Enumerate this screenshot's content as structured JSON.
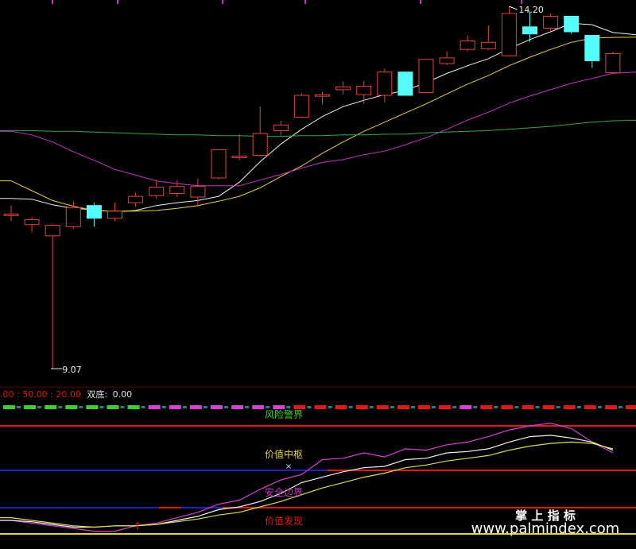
{
  "colors": {
    "background": "#000000",
    "up": "#e8413c",
    "down": "#54fcfc",
    "ma_white": "#f0f0f0",
    "ma_yellow": "#e6d23c",
    "ma_purple": "#c833c8",
    "ma_green": "#2ca84a",
    "divider": "#5a0c0c",
    "osc_white": "#f2f2f2",
    "osc_yellow": "#dede46",
    "osc_magenta": "#d83ed8",
    "red_line": "#e01818",
    "blue_line": "#1a22c0",
    "watermark": "#ffffff"
  },
  "chart_data": [
    {
      "type": "candlestick",
      "ylim": [
        8.6,
        14.5
      ],
      "candles": [
        {
          "o": 11.26,
          "h": 11.38,
          "l": 11.16,
          "c": 11.26
        },
        {
          "o": 11.11,
          "h": 11.22,
          "l": 11.0,
          "c": 11.18
        },
        {
          "o": 10.95,
          "h": 11.12,
          "l": 9.07,
          "c": 11.1
        },
        {
          "o": 11.08,
          "h": 11.44,
          "l": 11.05,
          "c": 11.35
        },
        {
          "o": 11.38,
          "h": 11.42,
          "l": 11.08,
          "c": 11.2
        },
        {
          "o": 11.2,
          "h": 11.42,
          "l": 11.16,
          "c": 11.3
        },
        {
          "o": 11.42,
          "h": 11.56,
          "l": 11.36,
          "c": 11.51
        },
        {
          "o": 11.52,
          "h": 11.74,
          "l": 11.48,
          "c": 11.64
        },
        {
          "o": 11.55,
          "h": 11.74,
          "l": 11.5,
          "c": 11.65
        },
        {
          "o": 11.5,
          "h": 11.76,
          "l": 11.36,
          "c": 11.65
        },
        {
          "o": 11.77,
          "h": 12.17,
          "l": 11.75,
          "c": 12.17
        },
        {
          "o": 12.06,
          "h": 12.39,
          "l": 12.02,
          "c": 12.08
        },
        {
          "o": 12.09,
          "h": 12.78,
          "l": 12.08,
          "c": 12.4
        },
        {
          "o": 12.44,
          "h": 12.58,
          "l": 12.37,
          "c": 12.52
        },
        {
          "o": 12.63,
          "h": 12.97,
          "l": 12.62,
          "c": 12.94
        },
        {
          "o": 12.95,
          "h": 12.99,
          "l": 12.81,
          "c": 12.95
        },
        {
          "o": 13.02,
          "h": 13.14,
          "l": 12.95,
          "c": 13.06
        },
        {
          "o": 12.95,
          "h": 13.14,
          "l": 12.82,
          "c": 13.07
        },
        {
          "o": 12.94,
          "h": 13.32,
          "l": 12.84,
          "c": 13.27
        },
        {
          "o": 13.27,
          "h": 13.27,
          "l": 12.94,
          "c": 12.94
        },
        {
          "o": 12.98,
          "h": 13.45,
          "l": 12.98,
          "c": 13.45
        },
        {
          "o": 13.39,
          "h": 13.56,
          "l": 13.37,
          "c": 13.47
        },
        {
          "o": 13.59,
          "h": 13.79,
          "l": 13.56,
          "c": 13.71
        },
        {
          "o": 13.6,
          "h": 13.93,
          "l": 13.58,
          "c": 13.69
        },
        {
          "o": 13.5,
          "h": 14.2,
          "l": 13.49,
          "c": 14.1
        },
        {
          "o": 13.91,
          "h": 14.13,
          "l": 13.7,
          "c": 13.81
        },
        {
          "o": 13.89,
          "h": 14.1,
          "l": 13.85,
          "c": 14.06
        },
        {
          "o": 14.06,
          "h": 14.06,
          "l": 13.81,
          "c": 13.84
        },
        {
          "o": 13.79,
          "h": 13.79,
          "l": 13.33,
          "c": 13.43
        },
        {
          "o": 13.26,
          "h": 13.56,
          "l": 13.26,
          "c": 13.53
        }
      ],
      "ma_lines": [
        {
          "color_key": "ma_white",
          "values": [
            11.48,
            11.47,
            11.39,
            11.34,
            11.32,
            11.29,
            11.31,
            11.38,
            11.42,
            11.45,
            11.51,
            11.71,
            12.0,
            12.25,
            12.46,
            12.64,
            12.78,
            12.87,
            12.95,
            13.01,
            13.12,
            13.25,
            13.36,
            13.46,
            13.6,
            13.73,
            13.84,
            13.96,
            13.94,
            13.83
          ]
        },
        {
          "color_key": "ma_yellow",
          "values": [
            11.73,
            11.59,
            11.45,
            11.37,
            11.31,
            11.3,
            11.3,
            11.31,
            11.34,
            11.38,
            11.44,
            11.51,
            11.63,
            11.79,
            11.94,
            12.12,
            12.28,
            12.43,
            12.56,
            12.69,
            12.82,
            12.96,
            13.1,
            13.22,
            13.36,
            13.48,
            13.59,
            13.69,
            13.75,
            13.76
          ]
        },
        {
          "color_key": "ma_purple",
          "values": [
            12.43,
            12.38,
            12.28,
            12.14,
            12.02,
            11.89,
            11.81,
            11.73,
            11.69,
            11.66,
            11.66,
            11.66,
            11.74,
            11.82,
            11.91,
            11.99,
            12.03,
            12.1,
            12.15,
            12.24,
            12.34,
            12.46,
            12.59,
            12.7,
            12.83,
            12.93,
            13.02,
            13.11,
            13.18,
            13.25
          ]
        },
        {
          "color_key": "ma_green",
          "values": [
            12.44,
            12.44,
            12.43,
            12.43,
            12.42,
            12.41,
            12.4,
            12.39,
            12.38,
            12.38,
            12.37,
            12.37,
            12.36,
            12.36,
            12.37,
            12.37,
            12.38,
            12.38,
            12.39,
            12.39,
            12.41,
            12.42,
            12.43,
            12.44,
            12.46,
            12.48,
            12.5,
            12.53,
            12.56,
            12.58
          ]
        }
      ],
      "annotations": {
        "high": "14.20",
        "low": "9.07"
      }
    },
    {
      "type": "line",
      "header": {
        "numbers": ".00 : 50.00 : 20.00",
        "label": "双底:",
        "value": "0.00"
      },
      "ylim": [
        0,
        100
      ],
      "levels": [
        {
          "label": "风险警界",
          "value": 80,
          "line_color_key": "red_line",
          "label_color": "#3ecf2e"
        },
        {
          "label": "价值中枢",
          "value": 50,
          "line_color_key": "red_line",
          "label_color": "#e6d23c"
        },
        {
          "label": "安全边界",
          "value": 20,
          "line_color_key": "red_line",
          "label_color": "#c833c8"
        },
        {
          "label": "价值发现",
          "value": 10,
          "line_color_key": "red_line",
          "label_color": "#e01818"
        }
      ],
      "series": [
        {
          "color_key": "osc_magenta",
          "values": [
            10,
            8,
            6,
            4,
            2,
            2,
            6,
            8,
            12,
            16,
            22,
            25,
            33,
            40,
            44,
            55,
            56,
            60,
            57,
            63,
            62,
            66,
            68,
            72,
            77,
            80,
            82,
            78,
            68,
            60
          ]
        },
        {
          "color_key": "osc_white",
          "values": [
            10,
            9,
            7,
            5,
            5,
            6,
            6,
            7,
            10,
            13,
            18,
            20,
            24,
            30,
            38,
            42,
            46,
            49,
            50,
            55,
            56,
            60,
            61,
            63,
            68,
            72,
            73,
            71,
            68,
            62
          ]
        },
        {
          "color_key": "osc_yellow",
          "values": [
            12,
            10,
            8,
            6,
            5,
            6,
            6,
            7,
            9,
            11,
            14,
            16,
            20,
            24,
            29,
            34,
            38,
            42,
            45,
            49,
            51,
            54,
            56,
            58,
            62,
            65,
            67,
            68,
            67,
            63
          ]
        }
      ]
    }
  ],
  "pane_labels": {
    "level1": "风险警界",
    "level2": "价值中枢",
    "level3": "安全边界",
    "level4": "价值发现",
    "cross": "×",
    "arrow": "↑"
  },
  "watermark": {
    "title": "掌 上 指 标",
    "url": "www.palmindex.com"
  }
}
